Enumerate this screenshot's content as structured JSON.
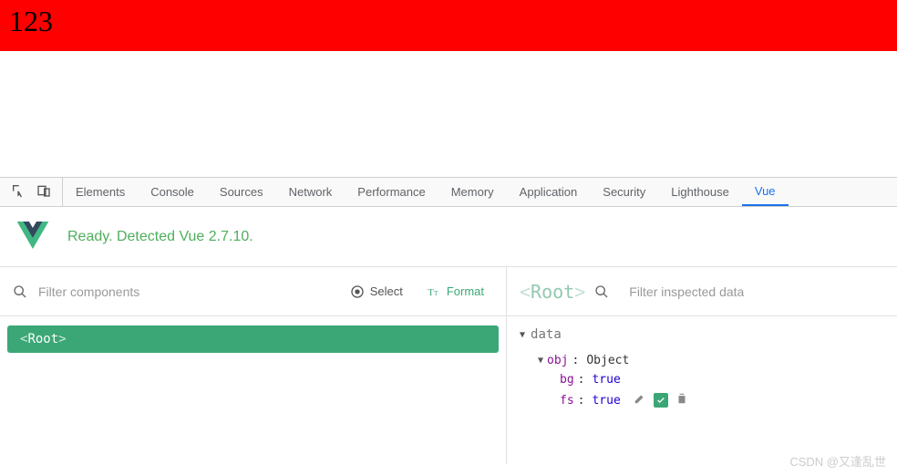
{
  "app": {
    "content": "123"
  },
  "devtools": {
    "tabs": [
      "Elements",
      "Console",
      "Sources",
      "Network",
      "Performance",
      "Memory",
      "Application",
      "Security",
      "Lighthouse",
      "Vue"
    ],
    "active_tab": "Vue"
  },
  "status": {
    "message": "Ready. Detected Vue 2.7.10."
  },
  "left": {
    "filter_placeholder": "Filter components",
    "select_label": "Select",
    "format_label": "Format",
    "root_label": "Root"
  },
  "right": {
    "inspected": "Root",
    "filter_placeholder": "Filter inspected data",
    "section_title": "data",
    "obj": {
      "key": "obj",
      "type": "Object",
      "props": [
        {
          "key": "bg",
          "value": "true"
        },
        {
          "key": "fs",
          "value": "true"
        }
      ]
    }
  },
  "watermark": "CSDN @又逢乱世"
}
